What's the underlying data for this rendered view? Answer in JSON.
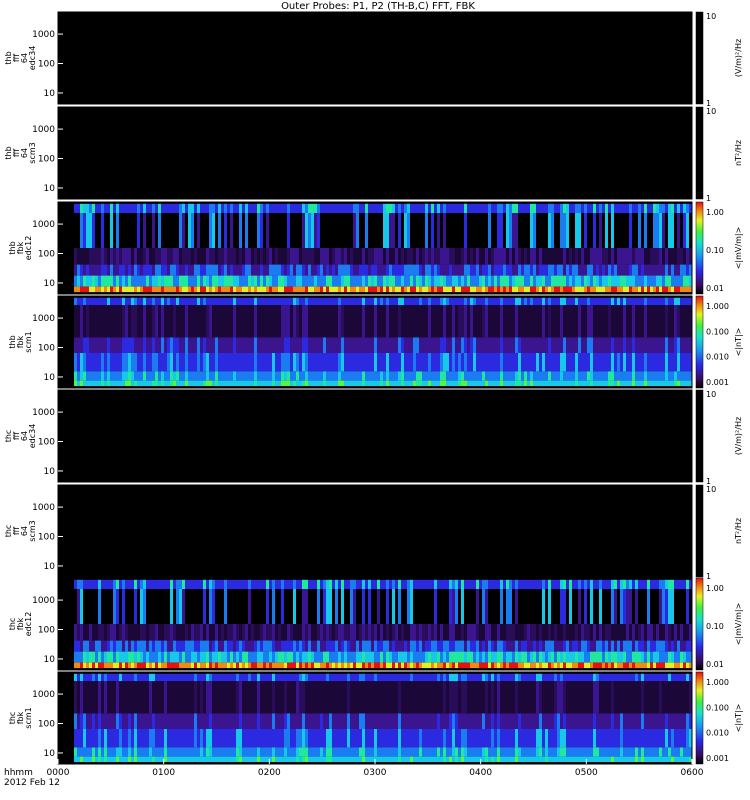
{
  "chart_data": {
    "type": "heatmap",
    "title": "Outer Probes: P1, P2 (TH-B,C) FFT, FBK",
    "x_title_top": "hhmm",
    "x_title_bottom": "2012 Feb 12",
    "x_ticks": [
      "0000",
      "0100",
      "0200",
      "0300",
      "0400",
      "0500",
      "0600"
    ],
    "colors": {
      "background": "#000000",
      "low": "#1a0a40",
      "mid": "#4a1fd8",
      "high": "#e8142c"
    },
    "panels": [
      {
        "label": [
          "thb",
          "fff",
          "64",
          "edc34"
        ],
        "cbar_label": "(V/m)²/Hz",
        "cbar_ticks": [
          "10",
          "1"
        ],
        "y_ticks": [
          "1000",
          "100",
          "10"
        ],
        "variant": "empty"
      },
      {
        "label": [
          "thb",
          "fff",
          "64",
          "scm3"
        ],
        "cbar_label": "nT²/Hz",
        "cbar_ticks": [
          "10",
          "1"
        ],
        "y_ticks": [
          "1000",
          "100",
          "10"
        ],
        "variant": "empty"
      },
      {
        "label": [
          "thb",
          "fbk",
          "edc12"
        ],
        "cbar_label": "<|mV/m|>",
        "cbar_ticks": [
          "1.00",
          "0.10",
          "0.01"
        ],
        "y_ticks": [
          "1000",
          "100",
          "10"
        ],
        "variant": "efield"
      },
      {
        "label": [
          "thb",
          "fbk",
          "scm1"
        ],
        "cbar_label": "<|nT|>",
        "cbar_ticks": [
          "1.000",
          "0.100",
          "0.010",
          "0.001"
        ],
        "y_ticks": [
          "1000",
          "100",
          "10"
        ],
        "variant": "scm"
      },
      {
        "label": [
          "thc",
          "fff",
          "64",
          "edc34"
        ],
        "cbar_label": "(V/m)²/Hz",
        "cbar_ticks": [
          "10",
          "1"
        ],
        "y_ticks": [
          "1000",
          "100",
          "10"
        ],
        "variant": "empty"
      },
      {
        "label": [
          "thc",
          "fff",
          "64",
          "scm3"
        ],
        "cbar_label": "nT²/Hz",
        "cbar_ticks": [
          "10",
          "1"
        ],
        "y_ticks": [
          "1000",
          "100",
          "10"
        ],
        "variant": "empty"
      },
      {
        "label": [
          "thc",
          "fbk",
          "edc12"
        ],
        "cbar_label": "<|mV/m|>",
        "cbar_ticks": [
          "1.00",
          "0.10",
          "0.01"
        ],
        "y_ticks": [
          "1000",
          "100",
          "10"
        ],
        "variant": "efield2"
      },
      {
        "label": [
          "thc",
          "fbk",
          "scm1"
        ],
        "cbar_label": "<|nT|>",
        "cbar_ticks": [
          "1.000",
          "0.100",
          "0.010",
          "0.001"
        ],
        "y_ticks": [
          "1000",
          "100",
          "10"
        ],
        "variant": "scm"
      }
    ]
  }
}
